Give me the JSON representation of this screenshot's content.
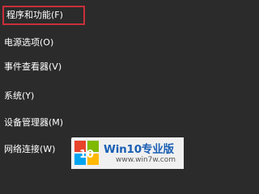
{
  "menu": {
    "items": [
      {
        "label": "程序和功能(F)",
        "highlighted": true
      },
      {
        "label": "电源选项(O)"
      },
      {
        "label": "事件查看器(V)"
      },
      {
        "label": "系统(Y)"
      },
      {
        "label": "设备管理器(M)"
      },
      {
        "label": "网络连接(W)"
      }
    ]
  },
  "watermark": {
    "title": "Win10专业版",
    "url": "www.win7w.com",
    "logo_text": "10",
    "logo_colors": [
      "#e8432b",
      "#7fba00",
      "#00a4ef",
      "#ffb900"
    ]
  },
  "colors": {
    "menu_background": "#2b2b2b",
    "text": "#ffffff",
    "highlight_border": "#c9303a",
    "brand_blue": "#1a5fb4"
  }
}
